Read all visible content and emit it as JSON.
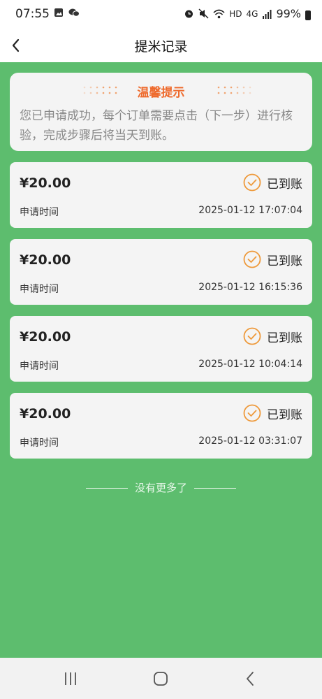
{
  "status_bar": {
    "time": "07:55",
    "battery": "99%",
    "network": "4G",
    "hd": "HD"
  },
  "header": {
    "title": "提米记录"
  },
  "tip": {
    "title": "温馨提示",
    "text": "您已申请成功，每个订单需要点击（下一步）进行核验，完成步骤后将当天到账。"
  },
  "records": [
    {
      "amount": "¥20.00",
      "status": "已到账",
      "time_label": "申请时间",
      "time": "2025-01-12 17:07:04"
    },
    {
      "amount": "¥20.00",
      "status": "已到账",
      "time_label": "申请时间",
      "time": "2025-01-12 16:15:36"
    },
    {
      "amount": "¥20.00",
      "status": "已到账",
      "time_label": "申请时间",
      "time": "2025-01-12 10:04:14"
    },
    {
      "amount": "¥20.00",
      "status": "已到账",
      "time_label": "申请时间",
      "time": "2025-01-12 03:31:07"
    }
  ],
  "footer": {
    "no_more": "没有更多了"
  },
  "colors": {
    "background_green": "#5dbd6e",
    "accent_orange": "#ee6a2c",
    "card": "#f4f4f4"
  },
  "icons": {
    "status": "check-circle-icon",
    "back": "chevron-left-icon"
  }
}
